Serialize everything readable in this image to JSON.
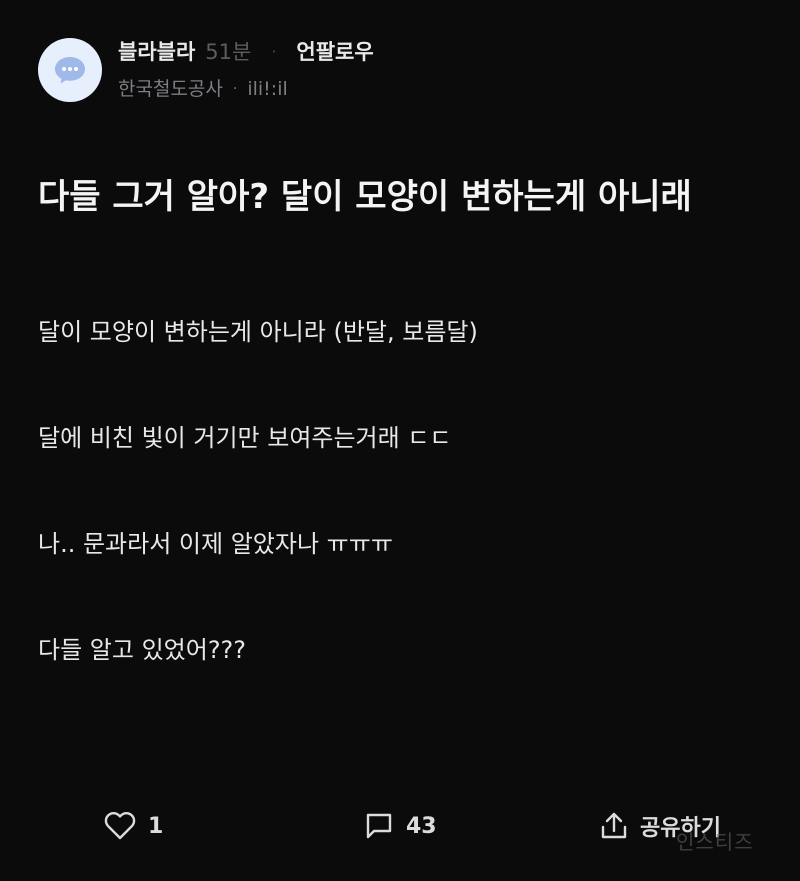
{
  "post": {
    "author": "블라블라",
    "time": "51분",
    "separator": "·",
    "follow_label": "언팔로우",
    "company": "한국철도공사",
    "company_sep": "·",
    "nickname": "ili!:il",
    "title": "다들 그거 알아? 달이 모양이 변하는게 아니래",
    "body": {
      "line1": "달이 모양이 변하는게 아니라 (반달, 보름달)",
      "line2": "달에 비친 빛이 거기만 보여주는거래 ㄷㄷ",
      "line3": "나.. 문과라서 이제 알았자나 ㅠㅠㅠ",
      "line4": "다들 알고 있었어???"
    }
  },
  "actions": {
    "like_count": "1",
    "comment_count": "43",
    "share_label": "공유하기"
  },
  "watermark": "인스티즈",
  "icons": {
    "avatar": "chat-bubble-icon",
    "like": "heart-icon",
    "comment": "comment-icon",
    "share": "share-icon"
  },
  "colors": {
    "background": "#0b0b0c",
    "avatar_bg": "#e7effd",
    "avatar_bubble": "#9fb9ea"
  }
}
